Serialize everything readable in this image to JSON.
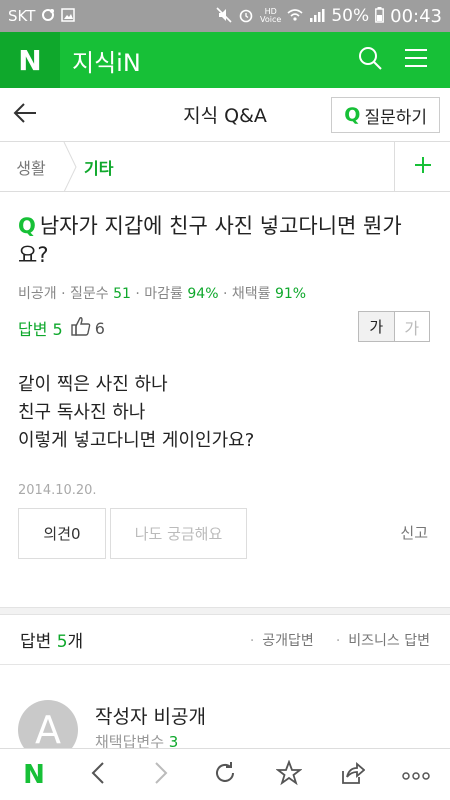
{
  "status_bar": {
    "carrier": "SKT",
    "battery": "50%",
    "time": "00:43",
    "icons": [
      "sync-icon",
      "image-icon",
      "mute-icon",
      "alarm-icon",
      "hd-voice-icon",
      "wifi-icon",
      "signal-icon",
      "battery-icon"
    ],
    "hd_label": "HD",
    "voice_label": "Voice"
  },
  "appbar": {
    "logo": "N",
    "title": "지식iN",
    "background": "#17c037"
  },
  "subheader": {
    "title": "지식 Q&A",
    "ask_q": "Q",
    "ask_label": "질문하기"
  },
  "breadcrumb": {
    "level1": "생활",
    "level2": "기타"
  },
  "question": {
    "q_mark": "Q",
    "title": "남자가 지갑에 친구 사진 넣고다니면 뭔가요?",
    "author": "비공개",
    "meta_question_label": "질문수",
    "meta_question_count": "51",
    "meta_deadline_label": "마감률",
    "meta_deadline_rate": "94%",
    "meta_adopt_label": "채택률",
    "meta_adopt_rate": "91%",
    "answers_label": "답변",
    "answers_count": "5",
    "likes": "6",
    "font_small": "가",
    "font_large": "가",
    "body_lines": [
      "같이 찍은 사진 하나",
      "친구 독사진 하나",
      "이렇게 넣고다니면 게이인가요?"
    ],
    "date": "2014.10.20.",
    "opinion_label": "의견",
    "opinion_count": "0",
    "curious_label": "나도 궁금해요",
    "report_label": "신고"
  },
  "answers_section": {
    "label": "답변",
    "count": "5",
    "unit": "개",
    "filter_public": "공개답변",
    "filter_business": "비즈니스 답변"
  },
  "first_answer": {
    "avatar_letter": "A",
    "author": "작성자 비공개",
    "adopted_label": "채택답변수",
    "adopted_count": "3"
  },
  "bottom_bar": {
    "logo": "N"
  }
}
